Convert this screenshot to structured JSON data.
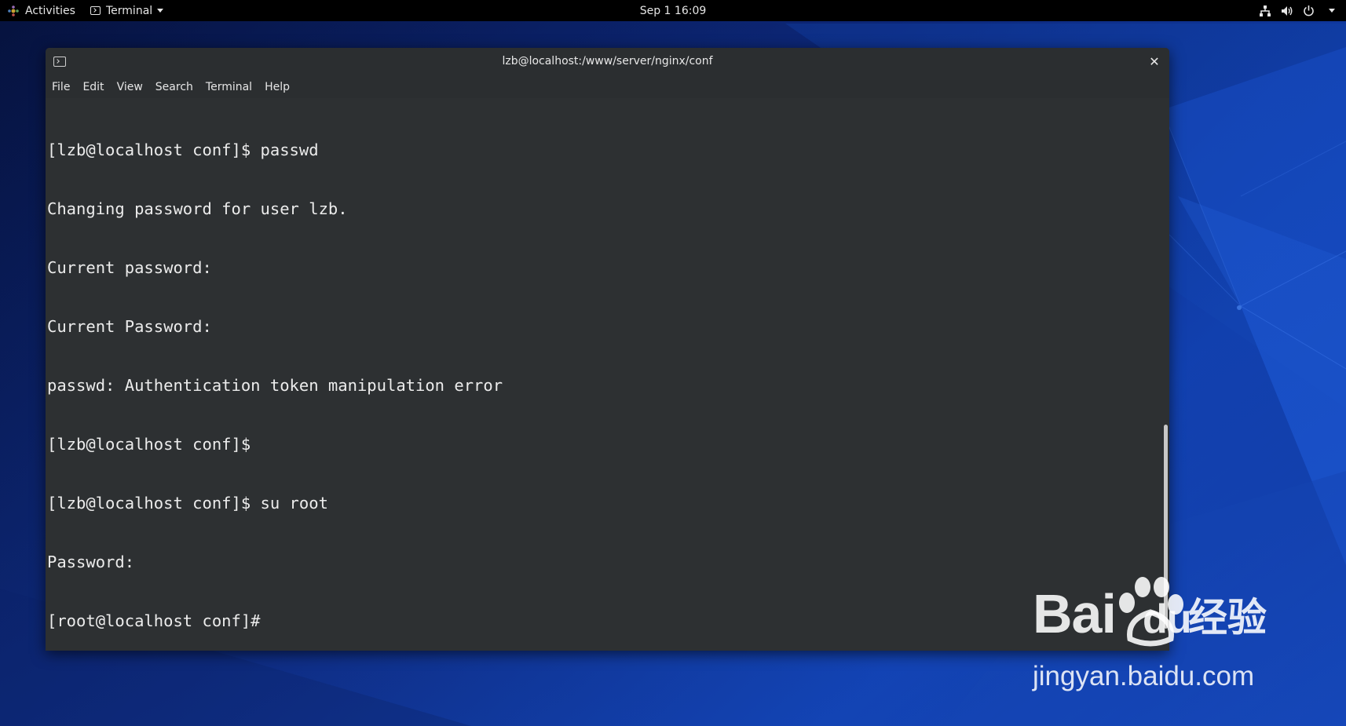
{
  "topbar": {
    "activities_label": "Activities",
    "app_menu_label": "Terminal",
    "clock": "Sep 1  16:09",
    "icons": [
      "network-icon",
      "volume-icon",
      "power-icon",
      "chevron-down-icon"
    ]
  },
  "window": {
    "title": "lzb@localhost:/www/server/nginx/conf",
    "close_symbol": "✕"
  },
  "menubar": {
    "items": [
      "File",
      "Edit",
      "View",
      "Search",
      "Terminal",
      "Help"
    ]
  },
  "terminal": {
    "lines": [
      "[lzb@localhost conf]$ passwd",
      "Changing password for user lzb.",
      "Current password:",
      "Current Password:",
      "passwd: Authentication token manipulation error",
      "[lzb@localhost conf]$",
      "[lzb@localhost conf]$ su root",
      "Password:",
      "[root@localhost conf]#"
    ]
  },
  "watermark": {
    "brand": "Bai",
    "brand_du": "du",
    "cn": "经验",
    "url": "jingyan.baidu.com"
  },
  "colors": {
    "terminal_bg": "#2d3032",
    "terminal_fg": "#ececec",
    "topbar_bg": "#000000"
  }
}
